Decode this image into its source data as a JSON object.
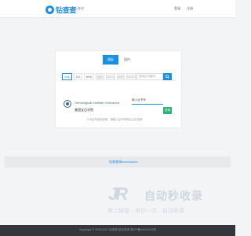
{
  "header": {
    "logo_text": "钻查查",
    "nav_recent": "钻石查询",
    "login": "登录",
    "register": "注册"
  },
  "card": {
    "tabs": [
      "国际",
      "国内"
    ],
    "filters": [
      {
        "label": "GIA",
        "state": "active"
      },
      {
        "label": "IGI",
        "state": "normal"
      },
      {
        "label": "HRD",
        "state": "normal"
      },
      {
        "label": "国检",
        "state": "muted"
      },
      {
        "label": "NGTC",
        "state": "muted"
      },
      {
        "label": "其他",
        "state": "muted"
      },
      {
        "label": "NGSTC",
        "state": "muted"
      }
    ],
    "search_placeholder": "搜索证书编号",
    "lab_name": "Gemological Institute of America",
    "lab_name_cn": "美国宝石学院",
    "cert_input_value": "输入证书号",
    "query_button": "查询",
    "hint": "GIA证书查询说明：请输入证书号码后点击查询"
  },
  "strip": {
    "link": "钻查查网",
    "value": "zuanchacha"
  },
  "watermark": {
    "jr": "JR",
    "title": "自动秒收录",
    "subtitle": "做上链接→来访一次→自动收录"
  },
  "footer": {
    "text": "Copyright © 2018-2021 钻查查 钻石查询 粤ICP备19014102号"
  },
  "colors": {
    "accent": "#1a8fe3",
    "query": "#2bb673",
    "footer_bg": "#33363b"
  }
}
